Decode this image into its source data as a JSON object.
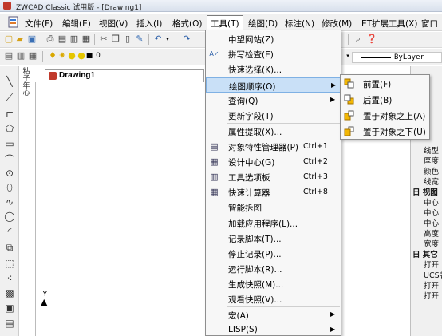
{
  "window": {
    "title": "ZWCAD Classic 试用版 - [Drawing1]"
  },
  "menubar": {
    "items": [
      "文件(F)",
      "编辑(E)",
      "视图(V)",
      "插入(I)",
      "格式(O)",
      "工具(T)",
      "绘图(D)",
      "标注(N)",
      "修改(M)",
      "ET扩展工具(X)",
      "窗口"
    ]
  },
  "toolbar": {
    "linetype_value": "ByLayer",
    "layer_value": "0"
  },
  "left_panel_vertical_text": [
    "粘",
    "子",
    "年",
    "心"
  ],
  "document": {
    "tab_label": "Drawing1",
    "ucs_y_label": "Y"
  },
  "tools_menu": {
    "items": [
      {
        "label": "中望网站(Z)",
        "shortcut": "",
        "submenu": false,
        "icon": ""
      },
      {
        "label": "拼写检查(E)",
        "shortcut": "",
        "submenu": false,
        "icon": "spellcheck-icon"
      },
      {
        "label": "快速选择(K)...",
        "shortcut": "",
        "submenu": false,
        "icon": ""
      },
      {
        "label": "绘图顺序(O)",
        "shortcut": "",
        "submenu": true,
        "icon": "",
        "highlighted": true
      },
      {
        "label": "查询(Q)",
        "shortcut": "",
        "submenu": true,
        "icon": ""
      },
      {
        "label": "更新字段(T)",
        "shortcut": "",
        "submenu": false,
        "icon": ""
      },
      {
        "label": "属性提取(X)...",
        "shortcut": "",
        "submenu": false,
        "icon": ""
      },
      {
        "label": "对象特性管理器(P)",
        "shortcut": "Ctrl+1",
        "submenu": false,
        "icon": "properties-icon"
      },
      {
        "label": "设计中心(G)",
        "shortcut": "Ctrl+2",
        "submenu": false,
        "icon": "design-center-icon"
      },
      {
        "label": "工具选项板",
        "shortcut": "Ctrl+3",
        "submenu": false,
        "icon": "tool-palette-icon"
      },
      {
        "label": "快速计算器",
        "shortcut": "Ctrl+8",
        "submenu": false,
        "icon": "calculator-icon"
      },
      {
        "label": "智能拆图",
        "shortcut": "",
        "submenu": false,
        "icon": ""
      },
      {
        "label": "加载应用程序(L)...",
        "shortcut": "",
        "submenu": false,
        "icon": ""
      },
      {
        "label": "记录脚本(T)...",
        "shortcut": "",
        "submenu": false,
        "icon": ""
      },
      {
        "label": "停止记录(P)...",
        "shortcut": "",
        "submenu": false,
        "icon": ""
      },
      {
        "label": "运行脚本(R)...",
        "shortcut": "",
        "submenu": false,
        "icon": ""
      },
      {
        "label": "生成快照(M)...",
        "shortcut": "",
        "submenu": false,
        "icon": ""
      },
      {
        "label": "观看快照(V)...",
        "shortcut": "",
        "submenu": false,
        "icon": ""
      },
      {
        "label": "宏(A)",
        "shortcut": "",
        "submenu": true,
        "icon": ""
      },
      {
        "label": "LISP(S)",
        "shortcut": "",
        "submenu": true,
        "icon": ""
      }
    ]
  },
  "draworder_submenu": {
    "items": [
      {
        "label": "前置(F)",
        "icon": "bring-to-front-icon"
      },
      {
        "label": "后置(B)",
        "icon": "send-to-back-icon"
      },
      {
        "label": "置于对象之上(A)",
        "icon": "bring-above-icon"
      },
      {
        "label": "置于对象之下(U)",
        "icon": "send-under-icon"
      }
    ]
  },
  "properties_panel": {
    "rows": [
      {
        "label": "线型",
        "section": false
      },
      {
        "label": "厚度",
        "section": false
      },
      {
        "label": "颜色",
        "section": false
      },
      {
        "label": "线宽",
        "section": false
      },
      {
        "label": "日 视图",
        "section": true
      },
      {
        "label": "中心",
        "section": false
      },
      {
        "label": "中心",
        "section": false
      },
      {
        "label": "中心",
        "section": false
      },
      {
        "label": "高度",
        "section": false
      },
      {
        "label": "宽度",
        "section": false
      },
      {
        "label": "日 其它",
        "section": true
      },
      {
        "label": "打开",
        "section": false
      },
      {
        "label": "UCS名",
        "section": false
      },
      {
        "label": "打开",
        "section": false
      },
      {
        "label": "打开",
        "section": false
      }
    ]
  },
  "colors": {
    "highlight": "#c9e0f7",
    "highlight_border": "#7fb1e4",
    "menu_bg": "#f7f7f7"
  }
}
